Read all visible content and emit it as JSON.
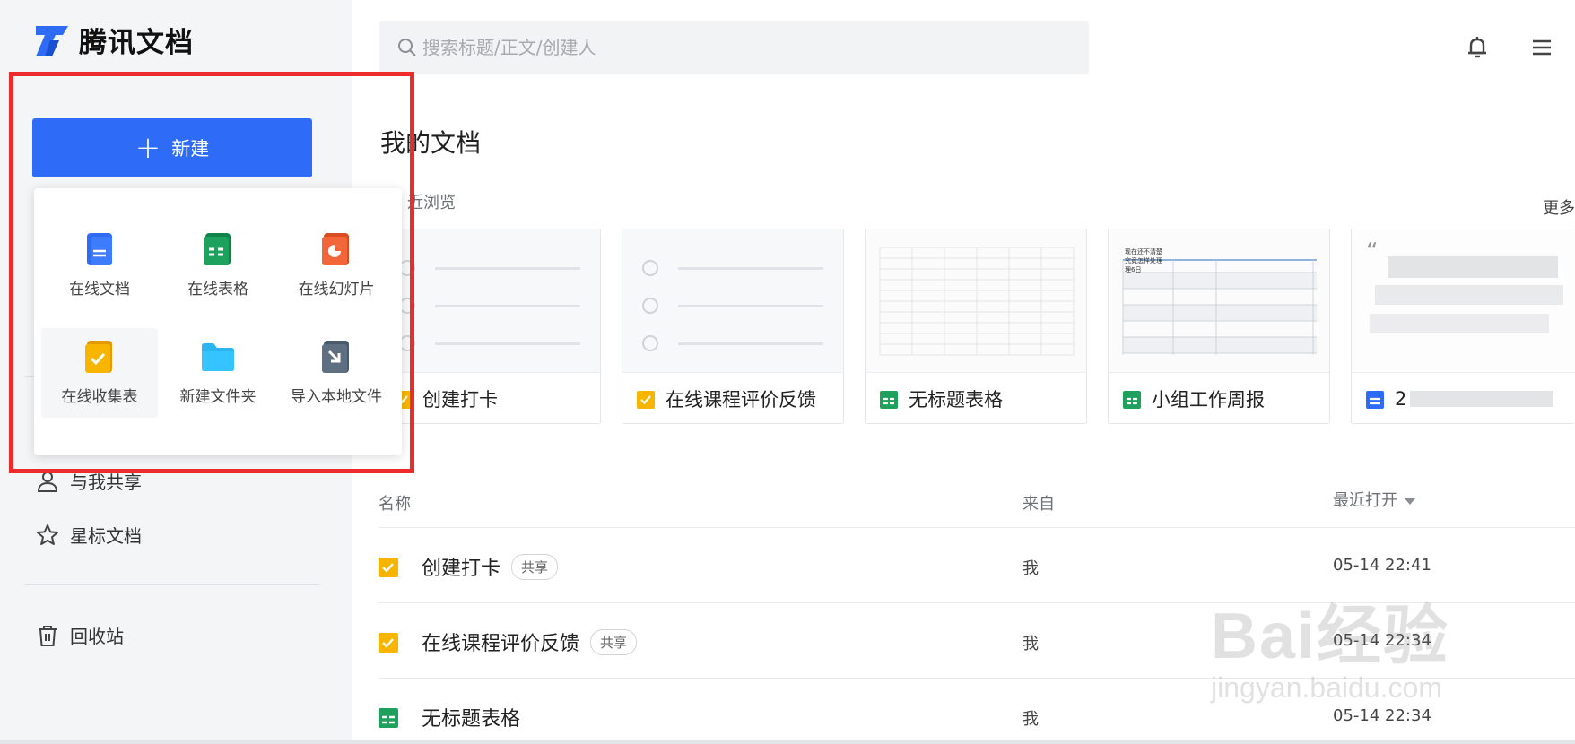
{
  "app": {
    "logo_text": "腾讯文档"
  },
  "sidebar": {
    "new_button_label": "新建",
    "items": [
      {
        "label": "与我共享",
        "icon": "person-icon"
      },
      {
        "label": "星标文档",
        "icon": "star-icon"
      },
      {
        "label": "回收站",
        "icon": "trash-icon"
      }
    ]
  },
  "new_menu": {
    "items": [
      {
        "label": "在线文档",
        "icon": "doc-icon"
      },
      {
        "label": "在线表格",
        "icon": "sheet-icon"
      },
      {
        "label": "在线幻灯片",
        "icon": "slides-icon"
      },
      {
        "label": "在线收集表",
        "icon": "form-icon"
      },
      {
        "label": "新建文件夹",
        "icon": "folder-icon"
      },
      {
        "label": "导入本地文件",
        "icon": "import-icon"
      }
    ]
  },
  "search": {
    "placeholder": "搜索标题/正文/创建人"
  },
  "header": {
    "icons": [
      "bell-icon",
      "menu-icon"
    ]
  },
  "main": {
    "title": "我的文档",
    "recent_label": "近浏览",
    "more_label": "更多",
    "cards": [
      {
        "title": "创建打卡",
        "type": "form"
      },
      {
        "title": "在线课程评价反馈",
        "type": "form"
      },
      {
        "title": "无标题表格",
        "type": "sheet"
      },
      {
        "title": "小组工作周报",
        "type": "sheet",
        "thumb_text": [
          "现在还不清楚",
          "究竟怎样处理",
          "理6日"
        ]
      },
      {
        "title": "2",
        "type": "doc"
      }
    ],
    "list": {
      "columns": {
        "name": "名称",
        "from": "来自",
        "opened": "最近打开"
      },
      "rows": [
        {
          "name": "创建打卡",
          "tag": "共享",
          "from": "我",
          "time": "05-14 22:41",
          "type": "form"
        },
        {
          "name": "在线课程评价反馈",
          "tag": "共享",
          "from": "我",
          "time": "05-14 22:34",
          "type": "form"
        },
        {
          "name": "无标题表格",
          "tag": "",
          "from": "我",
          "time": "05-14 22:34",
          "type": "sheet"
        }
      ]
    }
  },
  "watermark": {
    "brand": "Bai经验",
    "url": "jingyan.baidu.com"
  },
  "colors": {
    "accent": "#2e6bf6",
    "highlight": "#ee2b2b",
    "form": "#f7b500",
    "sheet": "#1da15c",
    "slides": "#f2663a"
  }
}
